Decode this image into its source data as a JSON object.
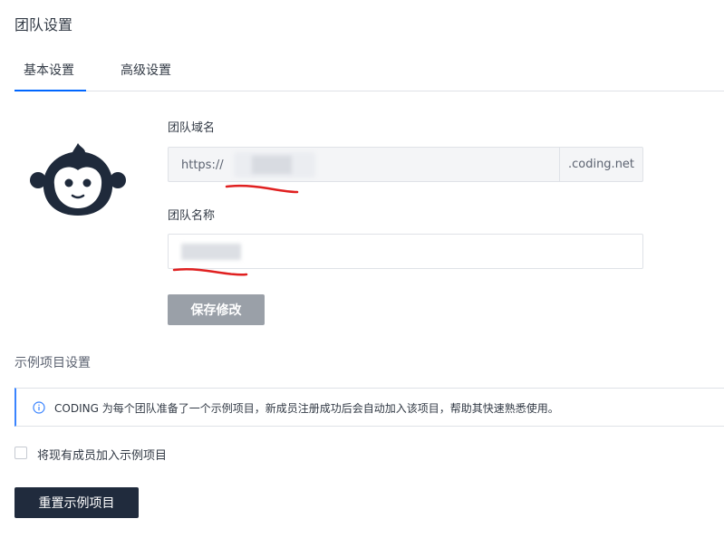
{
  "page": {
    "title": "团队设置"
  },
  "tabs": [
    {
      "label": "基本设置",
      "active": true
    },
    {
      "label": "高级设置",
      "active": false
    }
  ],
  "form": {
    "domain_label": "团队域名",
    "domain_prefix": "https://",
    "domain_value": "",
    "domain_suffix": ".coding.net",
    "name_label": "团队名称",
    "name_value": "",
    "save_label": "保存修改"
  },
  "demo": {
    "section_title": "示例项目设置",
    "info_text": "CODING 为每个团队准备了一个示例项目，新成员注册成功后会自动加入该项目，帮助其快速熟悉使用。",
    "checkbox_label": "将现有成员加入示例项目",
    "checkbox_checked": false,
    "reset_label": "重置示例项目"
  },
  "colors": {
    "accent": "#0066ff",
    "info_border": "#3a84ff",
    "dark_button": "#202b3d",
    "disabled_button": "#9aa0a8",
    "annotation_red": "#e02020"
  },
  "icons": {
    "logo": "monkey-logo-icon",
    "info": "info-circle-icon"
  }
}
